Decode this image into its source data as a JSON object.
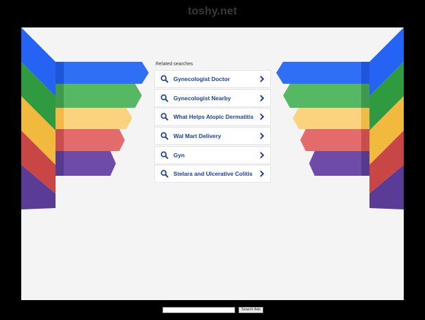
{
  "site": {
    "title": "toshy.net"
  },
  "related": {
    "heading": "Related searches",
    "items": [
      {
        "label": "Gynecologist Doctor"
      },
      {
        "label": "Gynecologist Nearby"
      },
      {
        "label": "What Helps Atopic Dermatitis"
      },
      {
        "label": "Wal Mart Delivery"
      },
      {
        "label": "Gyn"
      },
      {
        "label": "Stelara and Ulcerative Colitis"
      }
    ]
  },
  "search": {
    "button_label": "Search Ads",
    "value": ""
  },
  "colors": {
    "stripes": [
      "#2e6bf0",
      "#3aa048",
      "#f6c251",
      "#d94f4f",
      "#6a46a3"
    ],
    "link": "#1a3fa3",
    "panel_bg": "#f4f4f4"
  },
  "icons": {
    "item_icon": "search-icon",
    "item_arrow": "chevron-right-icon"
  }
}
